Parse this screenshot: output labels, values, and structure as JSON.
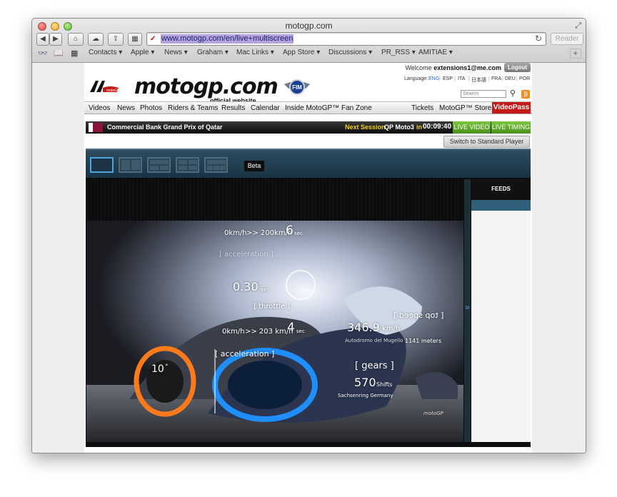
{
  "window": {
    "title": "motogp.com",
    "url": "www.motogp.com/en/live+multiscreen",
    "reader_label": "Reader",
    "reload_glyph": "↻"
  },
  "bookmarks": [
    "Contacts ▾",
    "Apple ▾",
    "News ▾",
    "Graham ▾",
    "Mac Links ▾",
    "App Store ▾",
    "Discussions ▾",
    "PR_RSS ▾",
    "AMITIAE ▾"
  ],
  "site": {
    "welcome_prefix": "Welcome",
    "welcome_user": "extensions1@me.com",
    "logout_label": "Logout",
    "logo_text": "motogp.com",
    "logo_sub": "official website",
    "fim_label": "FIM",
    "language_label": "Language:",
    "languages": [
      "ENG",
      "ESP",
      "ITA",
      "日本語",
      "FRA",
      "DEU",
      "POR"
    ],
    "search_placeholder": "Search",
    "nav": [
      "Videos",
      "News",
      "Photos",
      "Riders & Teams",
      "Results",
      "Calendar",
      "Inside MotoGP™",
      "Fan Zone"
    ],
    "tickets": "Tickets",
    "store": "MotoGP™ Store",
    "videopass": "VideoPass"
  },
  "event": {
    "name": "Commercial Bank Grand Prix of Qatar",
    "next_session_label": "Next Session",
    "session": "QP Moto3",
    "in_word": "in",
    "countdown": "00:09:40",
    "live_video": "LIVE VIDEO",
    "live_timing": "LIVE TIMING"
  },
  "player": {
    "switch_label": "Switch to Standard Player",
    "beta_label": "Beta",
    "feeds_label": "FEEDS",
    "overlays": {
      "speed_top_a": "0km/h",
      "speed_top_b": ">> 200km/h",
      "speed_top_sec": "6",
      "speed_top_unit": "sec",
      "acceleration_top": "[ acceleration ]",
      "throttle_val": "0.30",
      "throttle_unit": "sec",
      "throttle": "[ throttle ]",
      "speed_mid_a": "0km/h",
      "speed_mid_b": ">> 203 km/h",
      "speed_mid_sec": "4",
      "speed_mid_unit": "sec",
      "acceleration_mid": "[ acceleration ]",
      "top_speed_mirror": "[ top speed ]",
      "top_speed_val": "346.9",
      "top_speed_unit": "km/h",
      "top_speed_loc": "Autodromo del Mugello",
      "distance": "1141 meters",
      "lean_val": "10",
      "lean_unit": "°",
      "gears": "[ gears ]",
      "shifts_val": "570",
      "shifts_label": "Shifts",
      "shifts_loc": "Sachsenring Germany",
      "watermark": "motoGP"
    }
  },
  "colors": {
    "brand_red": "#c41a1a",
    "live_green": "#5aa82a",
    "countdown_yellow": "#f2d21e",
    "player_blue": "#2f5f7a"
  }
}
